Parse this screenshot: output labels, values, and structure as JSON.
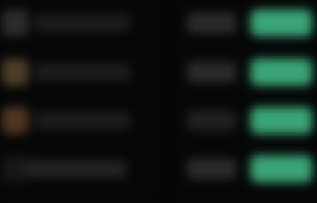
{
  "theme": {
    "background": "#050707",
    "accent": "#3aa377",
    "icon_amber": "#4b3d26",
    "icon_orange": "#50341f"
  },
  "rows": [
    {
      "icon": "app-icon",
      "title": "",
      "meta": "",
      "action_label": ""
    },
    {
      "icon": "app-icon",
      "title": "",
      "meta": "",
      "action_label": ""
    },
    {
      "icon": "app-icon",
      "title": "",
      "meta": "",
      "action_label": ""
    },
    {
      "icon": "app-icon",
      "title": "",
      "meta": "",
      "action_label": ""
    }
  ]
}
